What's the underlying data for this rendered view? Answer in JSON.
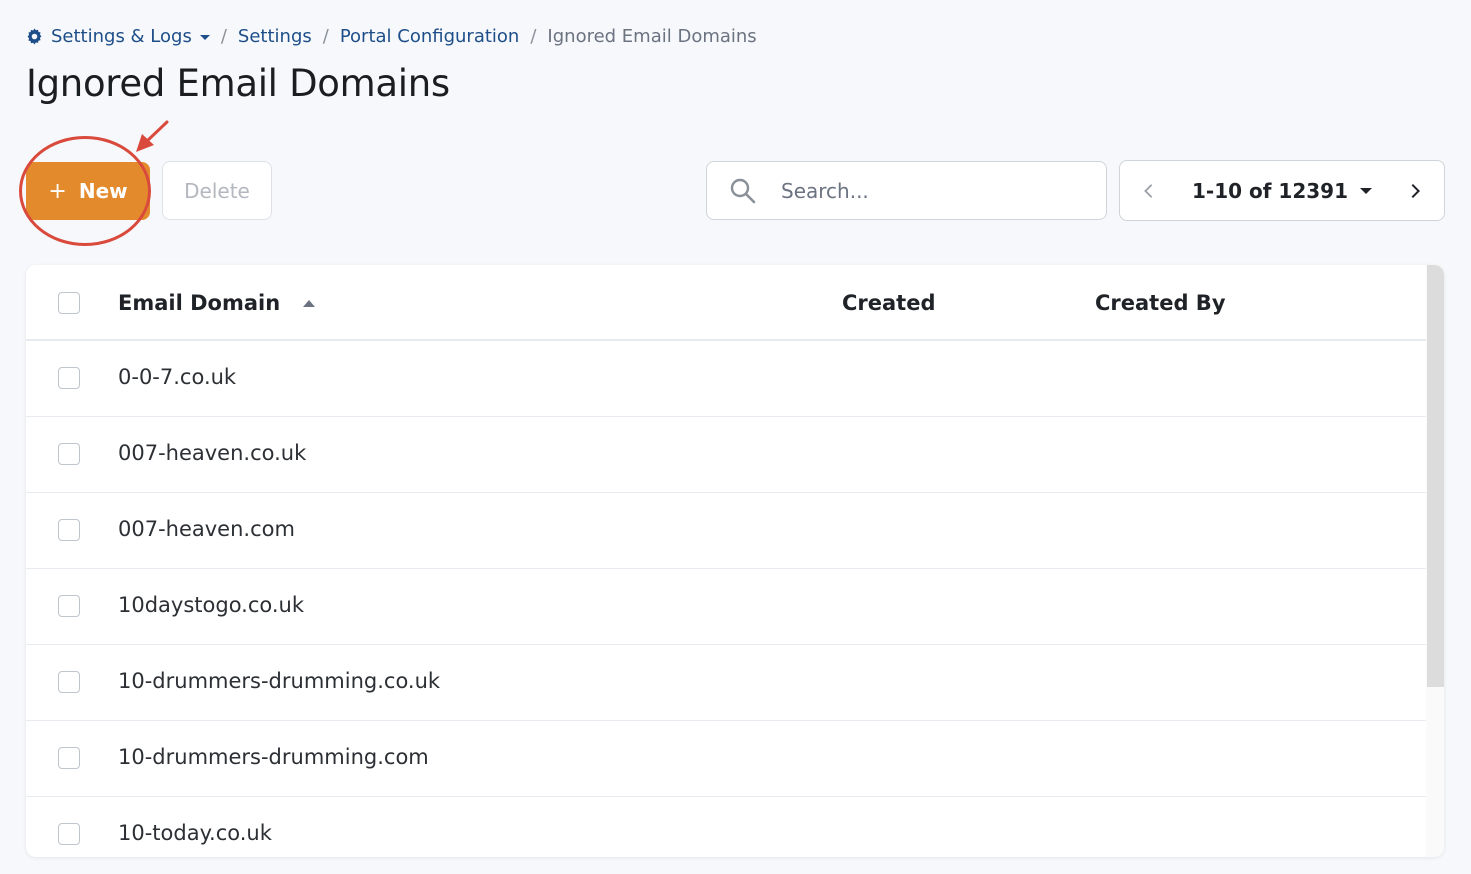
{
  "breadcrumb": {
    "root_label": "Settings & Logs",
    "items": [
      "Settings",
      "Portal Configuration"
    ],
    "current": "Ignored Email Domains",
    "separator": "/"
  },
  "page_title": "Ignored Email Domains",
  "toolbar": {
    "new_label": "New",
    "delete_label": "Delete"
  },
  "search": {
    "placeholder": "Search..."
  },
  "pager": {
    "range_label": "1-10 of 12391"
  },
  "table": {
    "columns": [
      "Email Domain",
      "Created",
      "Created By"
    ],
    "rows": [
      "0-0-7.co.uk",
      "007-heaven.co.uk",
      "007-heaven.com",
      "10daystogo.co.uk",
      "10-drummers-drumming.co.uk",
      "10-drummers-drumming.com",
      "10-today.co.uk"
    ]
  },
  "colors": {
    "primary_button": "#e38a2c",
    "link": "#1d4e89",
    "annotation": "#d94a3d"
  }
}
